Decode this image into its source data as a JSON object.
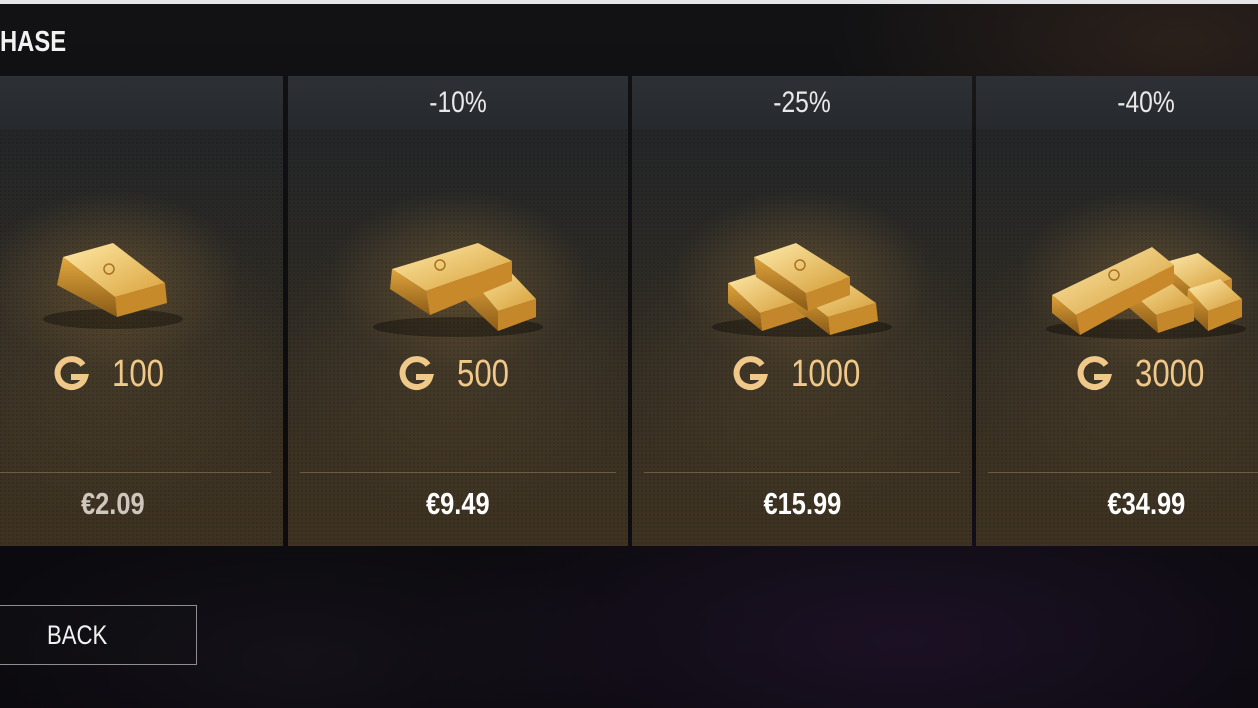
{
  "page": {
    "title": "HASE"
  },
  "offers": [
    {
      "discount": "",
      "amount": "100",
      "price": "€2.09",
      "currency_icon": "gold-g-icon",
      "art": "single-gold-bar"
    },
    {
      "discount": "-10%",
      "amount": "500",
      "price": "€9.49",
      "currency_icon": "gold-g-icon",
      "art": "two-gold-bars"
    },
    {
      "discount": "-25%",
      "amount": "1000",
      "price": "€15.99",
      "currency_icon": "gold-g-icon",
      "art": "gold-bar-pyramid"
    },
    {
      "discount": "-40%",
      "amount": "3000",
      "price": "€34.99",
      "currency_icon": "gold-g-icon",
      "art": "gold-bar-pile"
    }
  ],
  "navigation": {
    "back_label": "BACK"
  },
  "colors": {
    "amount_text": "#f0c98a",
    "gold_light": "#f7d27a",
    "gold_dark": "#b07a22",
    "header_bg": "#2b2e32"
  }
}
